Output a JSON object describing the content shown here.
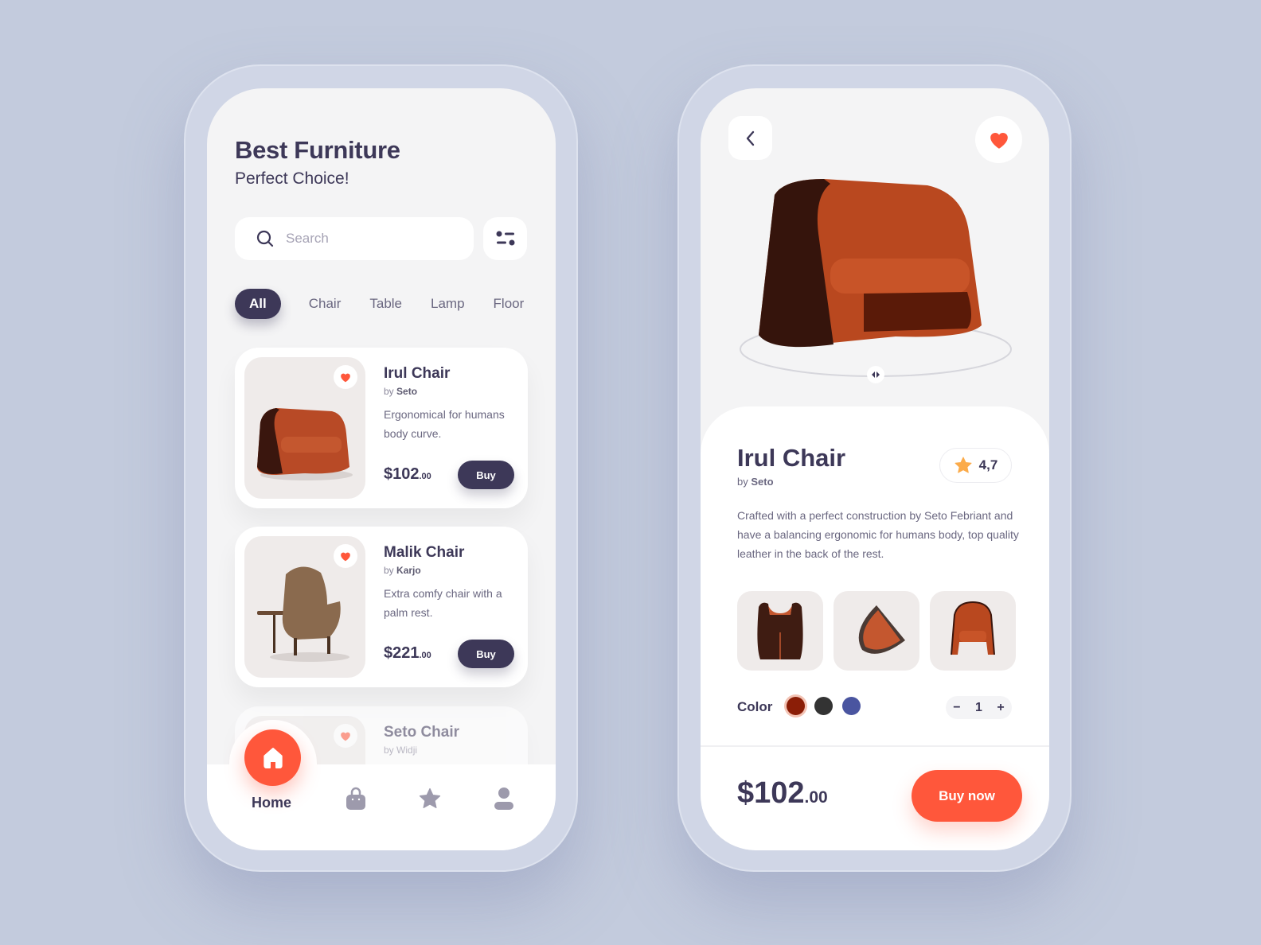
{
  "colors": {
    "accent": "#ff573b",
    "dark": "#3d3858",
    "bg": "#c3cbdd"
  },
  "list_screen": {
    "title": "Best Furniture",
    "subtitle": "Perfect Choice!",
    "search": {
      "placeholder": "Search",
      "icon": "search-icon"
    },
    "filter_icon": "sliders-icon",
    "categories": [
      {
        "label": "All",
        "active": true
      },
      {
        "label": "Chair",
        "active": false
      },
      {
        "label": "Table",
        "active": false
      },
      {
        "label": "Lamp",
        "active": false
      },
      {
        "label": "Floor",
        "active": false
      }
    ],
    "products": [
      {
        "name": "Irul Chair",
        "by_prefix": "by",
        "maker": "Seto",
        "desc": "Ergonomical for humans body curve.",
        "price": "$102",
        "cents": ".00",
        "buy": "Buy",
        "favorite": true
      },
      {
        "name": "Malik Chair",
        "by_prefix": "by",
        "maker": "Karjo",
        "desc": "Extra comfy chair with a palm rest.",
        "price": "$221",
        "cents": ".00",
        "buy": "Buy",
        "favorite": true
      },
      {
        "name": "Seto Chair",
        "by_prefix": "by",
        "maker": "Widji",
        "favorite": true
      }
    ],
    "nav": {
      "home": "Home",
      "items": [
        "home-icon",
        "bag-icon",
        "star-icon",
        "user-icon"
      ]
    }
  },
  "detail_screen": {
    "name": "Irul Chair",
    "by": "by",
    "maker": "Seto",
    "rating": "4,7",
    "description": "Crafted with a perfect construction by Seto Febriant and have a balancing ergonomic for humans body, top quality leather in the back of the rest.",
    "color_label": "Color",
    "colors": [
      "#8b1e07",
      "#333333",
      "#4a55a0"
    ],
    "selected_color": 0,
    "quantity": "1",
    "qty_minus": "−",
    "qty_plus": "+",
    "price": "$102",
    "cents": ".00",
    "buy_now": "Buy now"
  }
}
